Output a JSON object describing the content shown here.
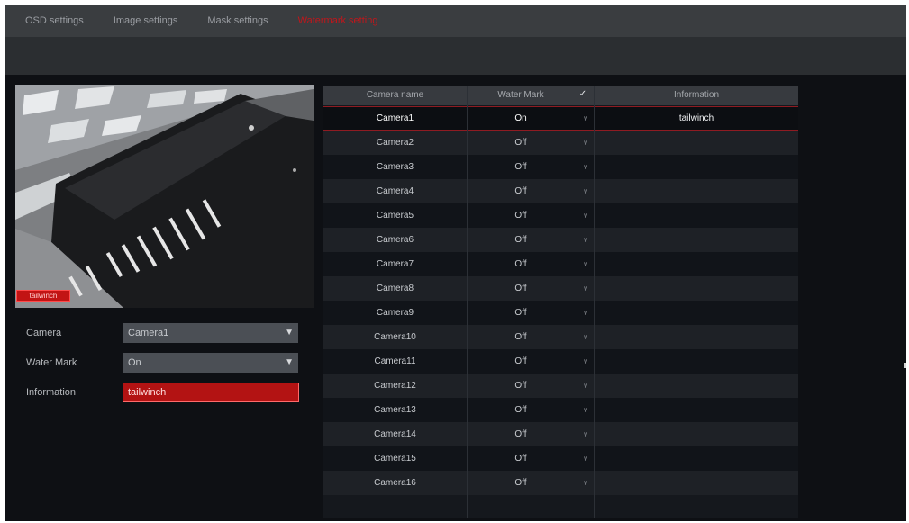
{
  "tabs": [
    {
      "label": "OSD settings",
      "active": false
    },
    {
      "label": "Image settings",
      "active": false
    },
    {
      "label": "Mask settings",
      "active": false
    },
    {
      "label": "Watermark setting",
      "active": true
    }
  ],
  "preview": {
    "badge_text": "tailwinch"
  },
  "form": {
    "camera_label": "Camera",
    "camera_value": "Camera1",
    "watermark_label": "Water Mark",
    "watermark_value": "On",
    "information_label": "Information",
    "information_value": "tailwinch"
  },
  "table": {
    "headers": {
      "camera_name": "Camera name",
      "water_mark": "Water Mark",
      "information": "Information"
    },
    "rows": [
      {
        "camera": "Camera1",
        "watermark": "On",
        "information": "tailwinch",
        "selected": true
      },
      {
        "camera": "Camera2",
        "watermark": "Off",
        "information": ""
      },
      {
        "camera": "Camera3",
        "watermark": "Off",
        "information": ""
      },
      {
        "camera": "Camera4",
        "watermark": "Off",
        "information": ""
      },
      {
        "camera": "Camera5",
        "watermark": "Off",
        "information": ""
      },
      {
        "camera": "Camera6",
        "watermark": "Off",
        "information": ""
      },
      {
        "camera": "Camera7",
        "watermark": "Off",
        "information": ""
      },
      {
        "camera": "Camera8",
        "watermark": "Off",
        "information": ""
      },
      {
        "camera": "Camera9",
        "watermark": "Off",
        "information": ""
      },
      {
        "camera": "Camera10",
        "watermark": "Off",
        "information": ""
      },
      {
        "camera": "Camera11",
        "watermark": "Off",
        "information": ""
      },
      {
        "camera": "Camera12",
        "watermark": "Off",
        "information": ""
      },
      {
        "camera": "Camera13",
        "watermark": "Off",
        "information": ""
      },
      {
        "camera": "Camera14",
        "watermark": "Off",
        "information": ""
      },
      {
        "camera": "Camera15",
        "watermark": "Off",
        "information": ""
      },
      {
        "camera": "Camera16",
        "watermark": "Off",
        "information": ""
      }
    ]
  },
  "icons": {
    "dropdown": "chevron-down-icon",
    "header_check": "checkmark-icon"
  },
  "colors": {
    "accent": "#c0161b",
    "background": "#0e1014",
    "tabbar": "#3a3d40"
  }
}
